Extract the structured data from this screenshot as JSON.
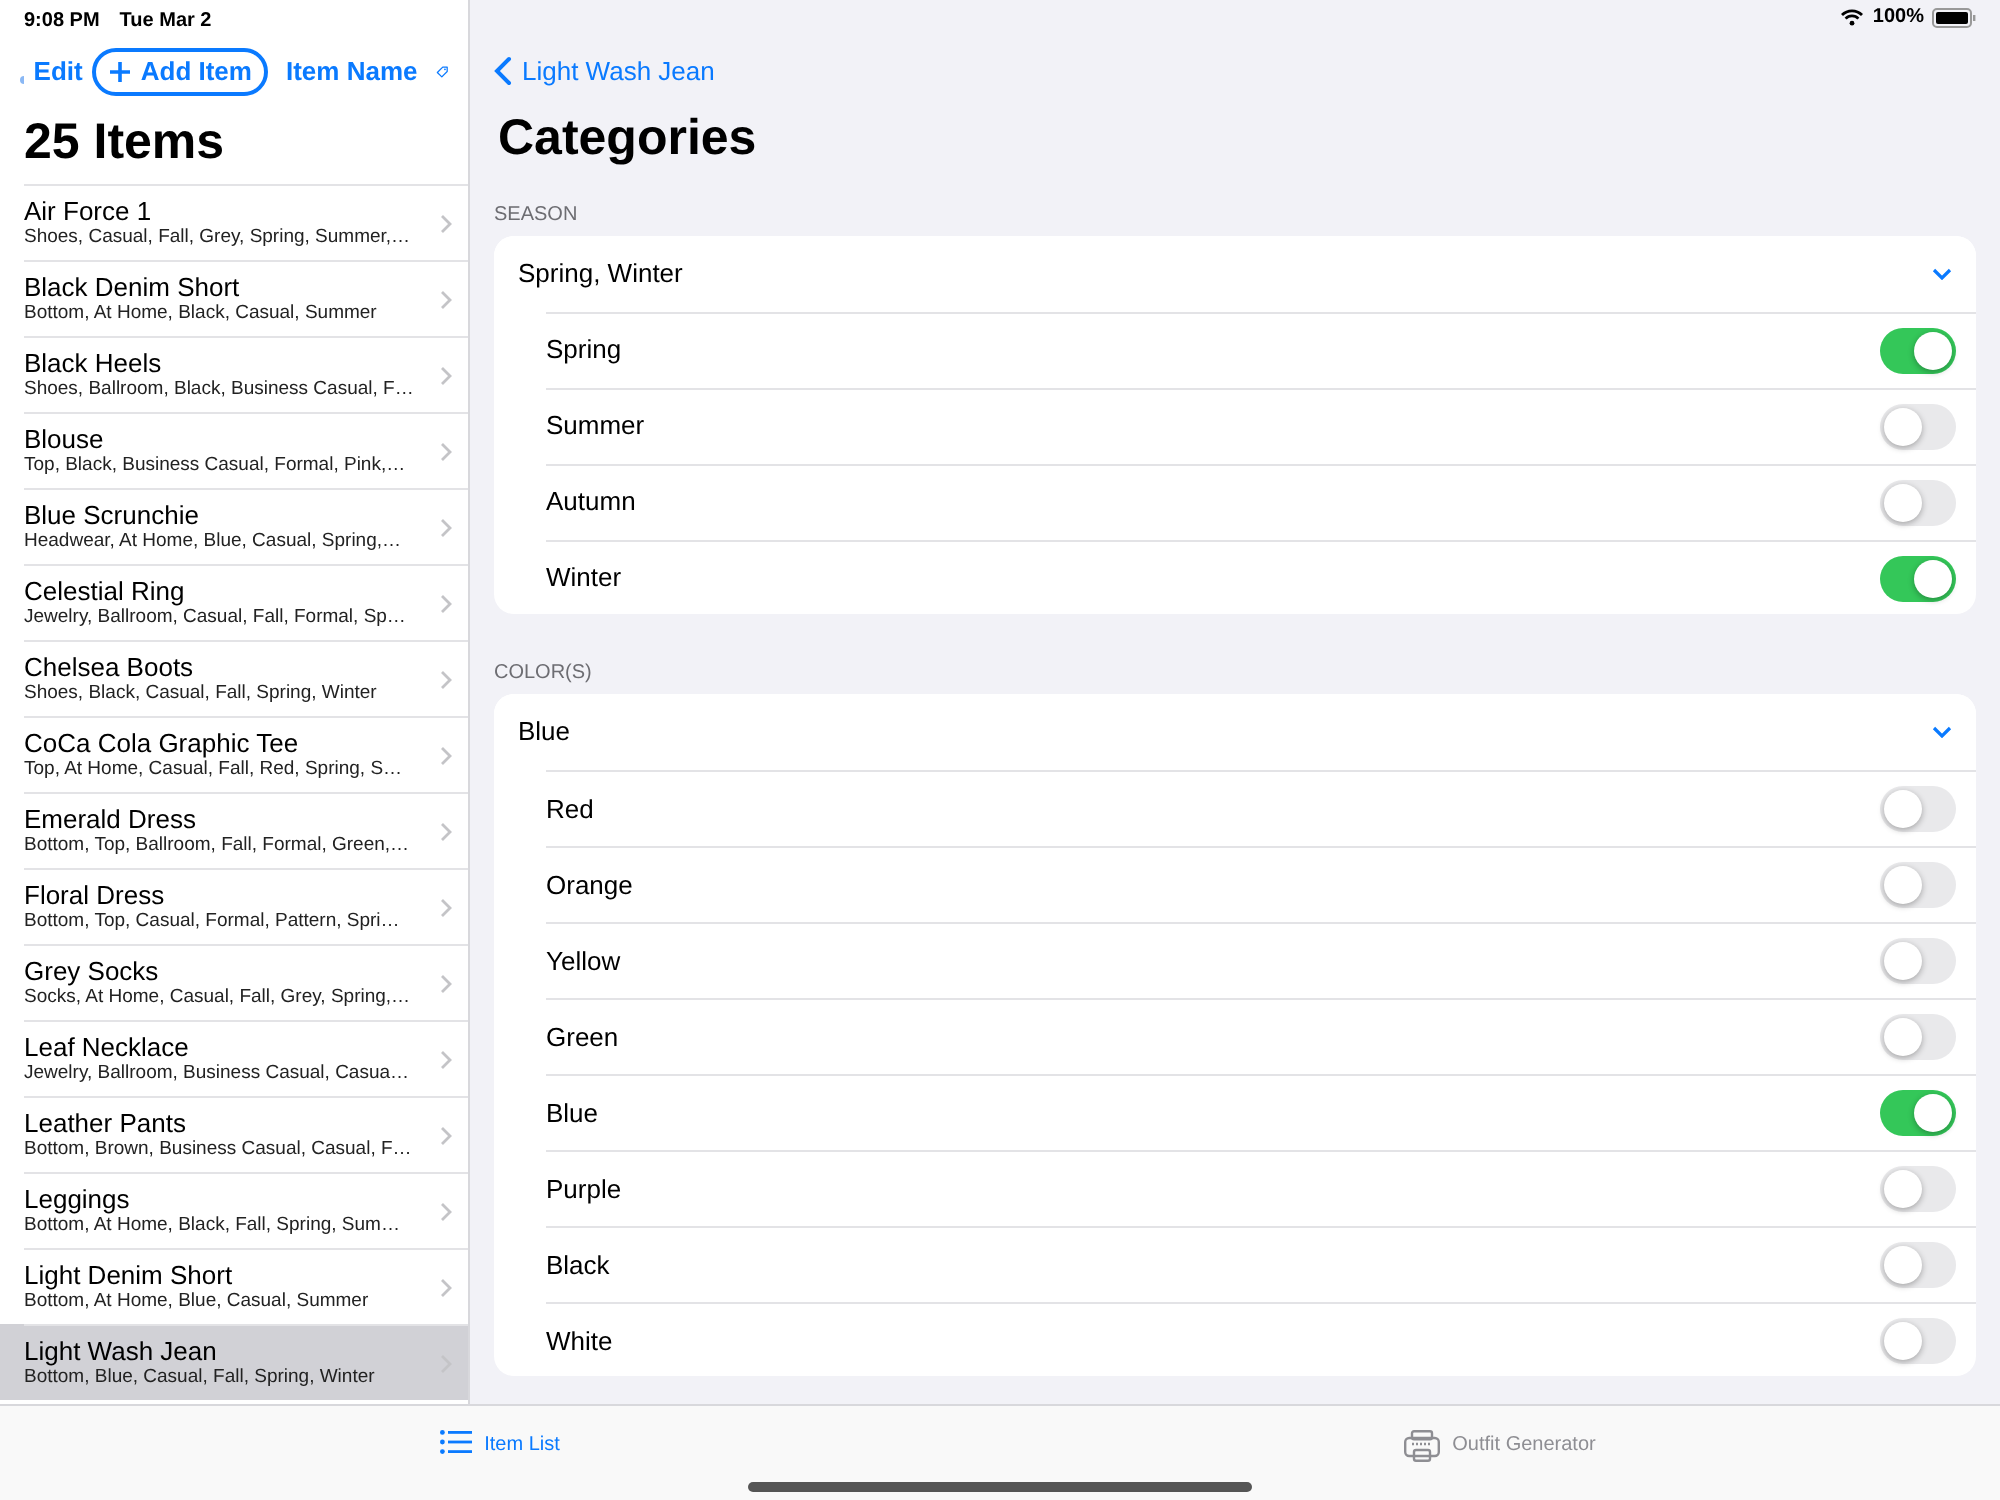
{
  "status_bar": {
    "time": "9:08 PM",
    "date": "Tue Mar 2",
    "battery": "100%"
  },
  "sidebar": {
    "nav": {
      "edit": "Edit",
      "add": "Add Item",
      "sort": "Item Name"
    },
    "title": "25 Items",
    "items": [
      {
        "name": "Air Force 1",
        "tags": "Shoes, Casual, Fall, Grey, Spring, Summer,…",
        "selected": false
      },
      {
        "name": "Black Denim Short",
        "tags": "Bottom, At Home, Black, Casual, Summer",
        "selected": false
      },
      {
        "name": "Black Heels",
        "tags": "Shoes, Ballroom, Black, Business Casual, F…",
        "selected": false
      },
      {
        "name": "Blouse",
        "tags": "Top, Black, Business Casual, Formal, Pink,…",
        "selected": false
      },
      {
        "name": "Blue Scrunchie",
        "tags": "Headwear, At Home, Blue, Casual, Spring,…",
        "selected": false
      },
      {
        "name": "Celestial Ring",
        "tags": "Jewelry, Ballroom, Casual, Fall, Formal, Sp…",
        "selected": false
      },
      {
        "name": "Chelsea Boots",
        "tags": "Shoes, Black, Casual, Fall, Spring, Winter",
        "selected": false
      },
      {
        "name": "CoCa Cola Graphic Tee",
        "tags": "Top, At Home, Casual, Fall, Red, Spring, S…",
        "selected": false
      },
      {
        "name": "Emerald Dress",
        "tags": "Bottom, Top, Ballroom, Fall, Formal, Green,…",
        "selected": false
      },
      {
        "name": "Floral Dress",
        "tags": "Bottom, Top, Casual, Formal, Pattern, Spri…",
        "selected": false
      },
      {
        "name": "Grey Socks",
        "tags": "Socks, At Home, Casual, Fall, Grey, Spring,…",
        "selected": false
      },
      {
        "name": "Leaf Necklace",
        "tags": "Jewelry, Ballroom, Business Casual, Casua…",
        "selected": false
      },
      {
        "name": "Leather Pants",
        "tags": "Bottom, Brown, Business Casual, Casual, F…",
        "selected": false
      },
      {
        "name": "Leggings",
        "tags": "Bottom, At Home, Black, Fall, Spring, Sum…",
        "selected": false
      },
      {
        "name": "Light Denim Short",
        "tags": "Bottom, At Home, Blue, Casual, Summer",
        "selected": false
      },
      {
        "name": "Light Wash Jean",
        "tags": "Bottom, Blue, Casual, Fall, Spring, Winter",
        "selected": true
      }
    ]
  },
  "detail": {
    "back": "Light Wash Jean",
    "title": "Categories",
    "sections": [
      {
        "header": "SEASON",
        "summary": "Spring, Winter",
        "expanded": true,
        "options": [
          {
            "label": "Spring",
            "on": true
          },
          {
            "label": "Summer",
            "on": false
          },
          {
            "label": "Autumn",
            "on": false
          },
          {
            "label": "Winter",
            "on": true
          }
        ]
      },
      {
        "header": "COLOR(S)",
        "summary": "Blue",
        "expanded": true,
        "options": [
          {
            "label": "Red",
            "on": false
          },
          {
            "label": "Orange",
            "on": false
          },
          {
            "label": "Yellow",
            "on": false
          },
          {
            "label": "Green",
            "on": false
          },
          {
            "label": "Blue",
            "on": true
          },
          {
            "label": "Purple",
            "on": false
          },
          {
            "label": "Black",
            "on": false
          },
          {
            "label": "White",
            "on": false
          }
        ]
      }
    ]
  },
  "tab_bar": [
    {
      "label": "Item List",
      "selected": true
    },
    {
      "label": "Outfit Generator",
      "selected": false
    }
  ]
}
